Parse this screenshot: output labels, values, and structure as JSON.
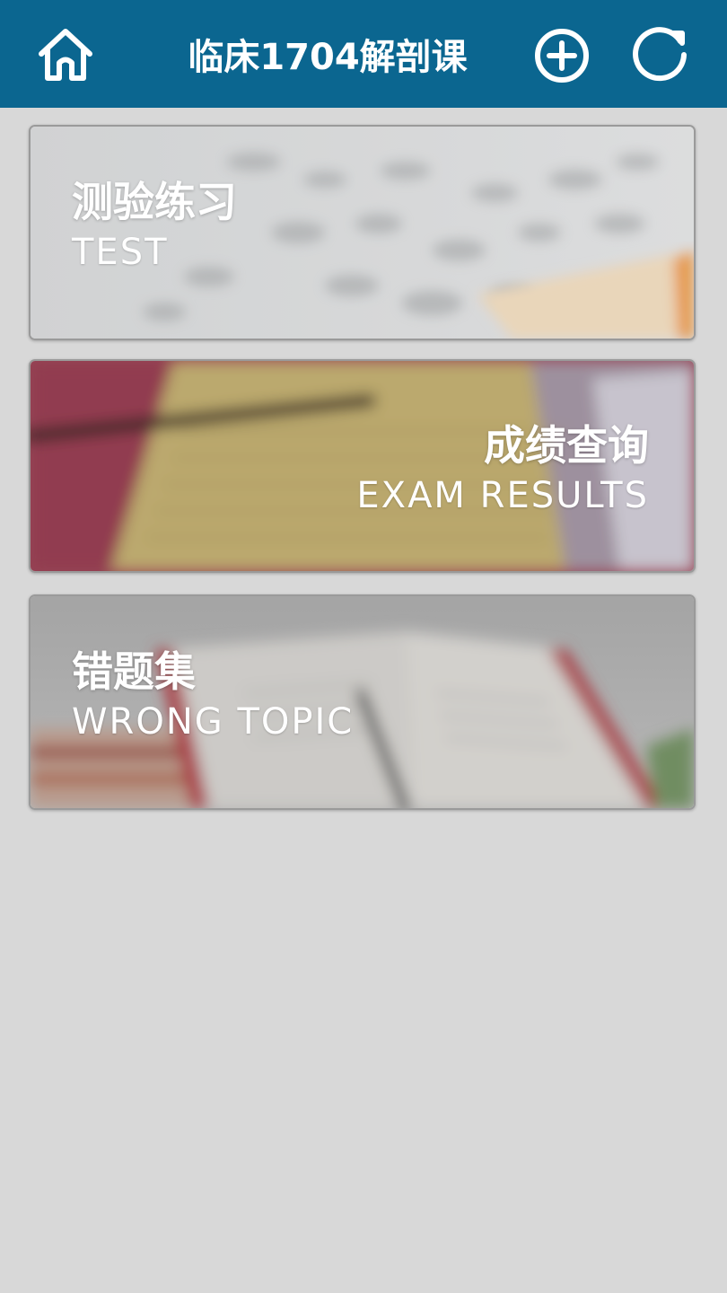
{
  "header": {
    "title": "临床1704解剖课",
    "home_icon": "home-icon",
    "add_icon": "plus-circle-icon",
    "refresh_icon": "refresh-icon",
    "bg_color": "#0b6690"
  },
  "menu": [
    {
      "title_cn": "测验练习",
      "title_en": "TEST"
    },
    {
      "title_cn": "成绩查询",
      "title_en": "EXAM RESULTS"
    },
    {
      "title_cn": "错题集",
      "title_en": "WRONG TOPIC"
    }
  ],
  "colors": {
    "page_bg": "#d8d8d8",
    "header_bg": "#0b6690",
    "text": "#ffffff"
  }
}
